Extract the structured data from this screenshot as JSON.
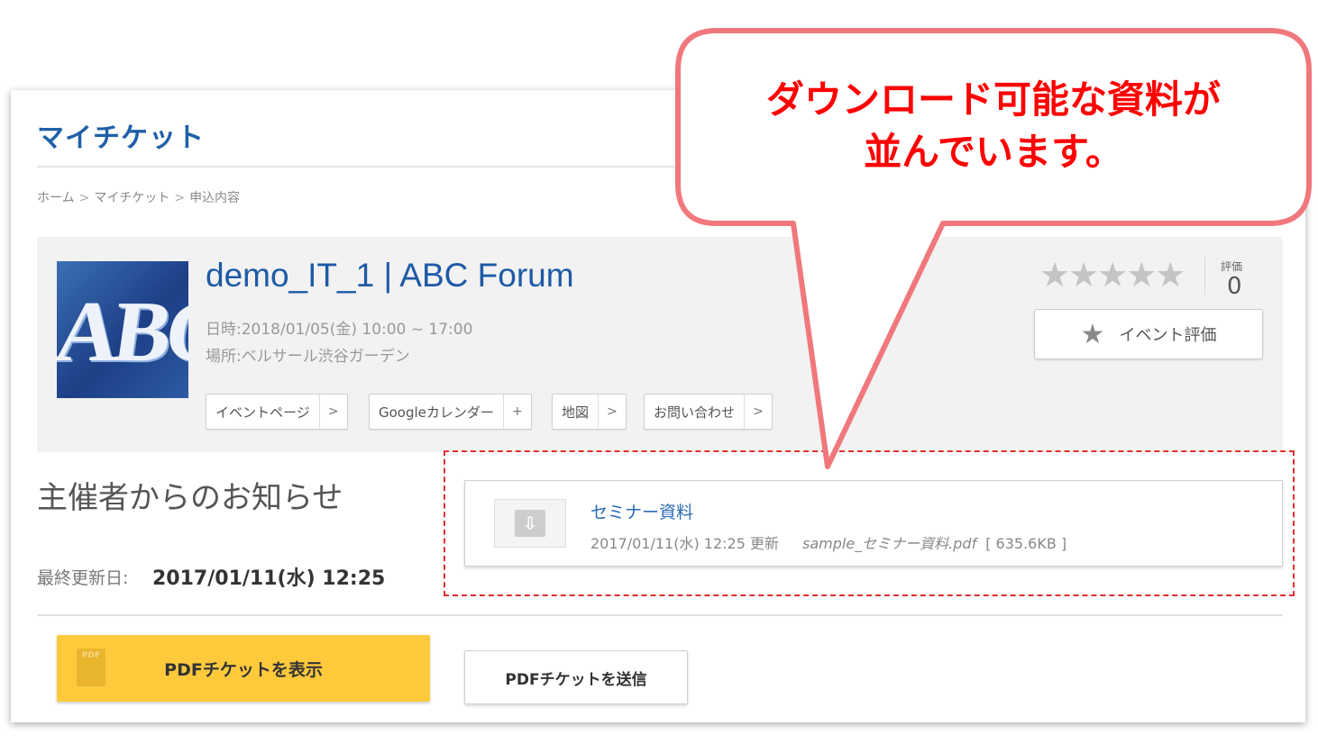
{
  "page": {
    "title": "マイチケット",
    "breadcrumb": [
      "ホーム",
      "マイチケット",
      "申込内容"
    ],
    "breadcrumb_sep": ">"
  },
  "event": {
    "logo_text": "ABC",
    "name": "demo_IT_1 | ABC Forum",
    "date": "日時:2018/01/05(金) 10:00 ~ 17:00",
    "place": "場所:ベルサール渋谷ガーデン",
    "links": [
      {
        "label": "イベントページ",
        "icon": ">"
      },
      {
        "label": "Googleカレンダー",
        "icon": "+"
      },
      {
        "label": "地図",
        "icon": ">"
      },
      {
        "label": "お問い合わせ",
        "icon": ">"
      }
    ],
    "rating": {
      "stars": "★★★★★",
      "label": "評価",
      "value": "0",
      "button_label": "イベント評価"
    }
  },
  "notice": {
    "heading": "主催者からのお知らせ",
    "updated_label": "最終更新日:",
    "updated_value": "2017/01/11(水) 12:25"
  },
  "document": {
    "title": "セミナー資料",
    "updated": "2017/01/11(水) 12:25 更新",
    "filename": "sample_セミナー資料.pdf",
    "size": "[ 635.6KB ]"
  },
  "actions": {
    "pdf_show": "PDFチケットを表示",
    "pdf_icon_text": "PDF",
    "pdf_send": "PDFチケットを送信"
  },
  "annotation": {
    "line1": "ダウンロード可能な資料が",
    "line2": "並んでいます。",
    "border_color": "#f0787c",
    "text_color": "#ff0000"
  }
}
